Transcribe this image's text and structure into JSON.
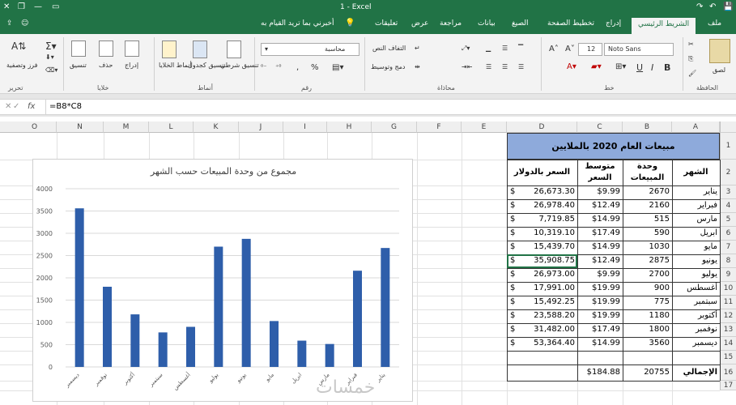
{
  "titlebar": {
    "title": "1 - Excel"
  },
  "tabs": [
    {
      "id": "file",
      "label": "ملف"
    },
    {
      "id": "home",
      "label": "الشريط الرئيسي"
    },
    {
      "id": "insert",
      "label": "إدراج"
    },
    {
      "id": "layout",
      "label": "تخطيط الصفحة"
    },
    {
      "id": "formulas",
      "label": "الصيغ"
    },
    {
      "id": "data",
      "label": "بيانات"
    },
    {
      "id": "review",
      "label": "مراجعة"
    },
    {
      "id": "view",
      "label": "عرض"
    },
    {
      "id": "comments",
      "label": "تعليقات"
    }
  ],
  "tell_me": "أخبرني بما تريد القيام به",
  "ribbon": {
    "paste": "لصق",
    "clipboard": "الحافظة",
    "font_name": "Noto Sans",
    "font_size": "12",
    "font_group": "خط",
    "wrap_text": "التفاف النص",
    "merge_center": "دمج وتوسيط",
    "alignment_group": "محاذاة",
    "number_format": "محاسبة",
    "number_group": "رقم",
    "cond_format": "تنسيق شرطي",
    "format_table": "تنسيق كجدول",
    "cell_styles": "أنماط الخلايا",
    "styles_group": "أنماط",
    "insert": "إدراج",
    "delete": "حذف",
    "format": "تنسيق",
    "cells_group": "خلايا",
    "sort_filter": "فرز وتصفية",
    "editing_group": "تحرير",
    "bold": "B",
    "italic": "I",
    "underline": "U",
    "percent": "%",
    "comma": ","
  },
  "formula_bar": {
    "fx": "fx",
    "formula": "=B8*C8"
  },
  "columns": [
    "O",
    "N",
    "M",
    "L",
    "K",
    "J",
    "I",
    "H",
    "G",
    "F",
    "E",
    "D",
    "C",
    "B",
    "A"
  ],
  "rows": [
    "1",
    "2",
    "3",
    "4",
    "5",
    "6",
    "7",
    "8",
    "9",
    "10",
    "11",
    "12",
    "13",
    "14",
    "15",
    "16",
    "17"
  ],
  "table": {
    "title": "مبيعات العام 2020 بالملايين",
    "headers": {
      "month": "الشهر",
      "units": "وحدة المبيعات",
      "avg_price": "متوسط السعر",
      "usd": "السعر بالدولار"
    },
    "rows": [
      {
        "month": "يناير",
        "units": "2670",
        "avg": "$9.99",
        "cur": "$",
        "usd": "26,673.30"
      },
      {
        "month": "فبراير",
        "units": "2160",
        "avg": "$12.49",
        "cur": "$",
        "usd": "26,978.40"
      },
      {
        "month": "مارس",
        "units": "515",
        "avg": "$14.99",
        "cur": "$",
        "usd": "7,719.85"
      },
      {
        "month": "ابريل",
        "units": "590",
        "avg": "$17.49",
        "cur": "$",
        "usd": "10,319.10"
      },
      {
        "month": "مايو",
        "units": "1030",
        "avg": "$14.99",
        "cur": "$",
        "usd": "15,439.70"
      },
      {
        "month": "يونيو",
        "units": "2875",
        "avg": "$12.49",
        "cur": "$",
        "usd": "35,908.75"
      },
      {
        "month": "يوليو",
        "units": "2700",
        "avg": "$9.99",
        "cur": "$",
        "usd": "26,973.00"
      },
      {
        "month": "أغسطس",
        "units": "900",
        "avg": "$19.99",
        "cur": "$",
        "usd": "17,991.00"
      },
      {
        "month": "سبتمبر",
        "units": "775",
        "avg": "$19.99",
        "cur": "$",
        "usd": "15,492.25"
      },
      {
        "month": "أكتوبر",
        "units": "1180",
        "avg": "$19.99",
        "cur": "$",
        "usd": "23,588.20"
      },
      {
        "month": "نوفمبر",
        "units": "1800",
        "avg": "$17.49",
        "cur": "$",
        "usd": "31,482.00"
      },
      {
        "month": "ديسمبر",
        "units": "3560",
        "avg": "$14.99",
        "cur": "$",
        "usd": "53,364.40"
      }
    ],
    "total": {
      "label": "الإجمالي",
      "units": "20755",
      "avg": "$184.88"
    }
  },
  "chart_data": {
    "type": "bar",
    "title": "مجموع من وحدة المبيعات حسب الشهر",
    "categories": [
      "يناير",
      "فبراير",
      "مارس",
      "ابريل",
      "مايو",
      "يونيو",
      "يوليو",
      "أغسطس",
      "سبتمبر",
      "أكتوبر",
      "نوفمبر",
      "ديسمبر"
    ],
    "values": [
      2670,
      2160,
      515,
      590,
      1030,
      2875,
      2700,
      900,
      775,
      1180,
      1800,
      3560
    ],
    "yticks": [
      "0",
      "500",
      "1000",
      "1500",
      "2000",
      "2500",
      "3000",
      "3500",
      "4000"
    ],
    "ylim": [
      0,
      4000
    ],
    "direction": "rtl",
    "grid": true,
    "bar_color": "#2e5eaa"
  },
  "colors": {
    "accent": "#217346",
    "title_fill": "#8eaadb",
    "bar": "#2e5eaa"
  }
}
